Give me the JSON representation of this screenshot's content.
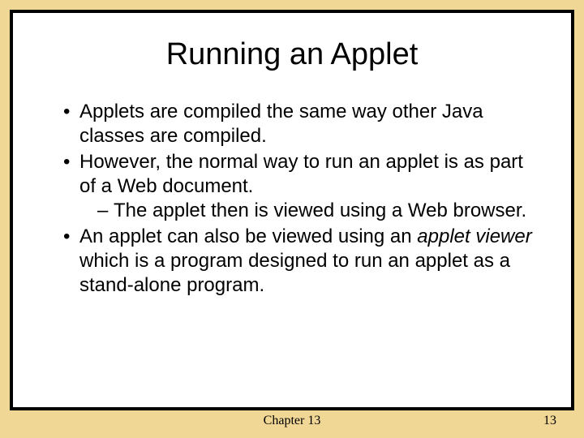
{
  "title": "Running an Applet",
  "bullets": {
    "b1": "Applets are compiled the same way other Java classes are compiled.",
    "b2": "However, the normal way to run an applet is as part of a Web document.",
    "b2_sub": "The applet then is viewed using a Web browser.",
    "b3_pre": "An applet can also be viewed using an ",
    "b3_em": "applet viewer",
    "b3_post": " which is a program designed to run an applet as a stand-alone program."
  },
  "footer": {
    "chapter": "Chapter 13",
    "page": "13"
  }
}
